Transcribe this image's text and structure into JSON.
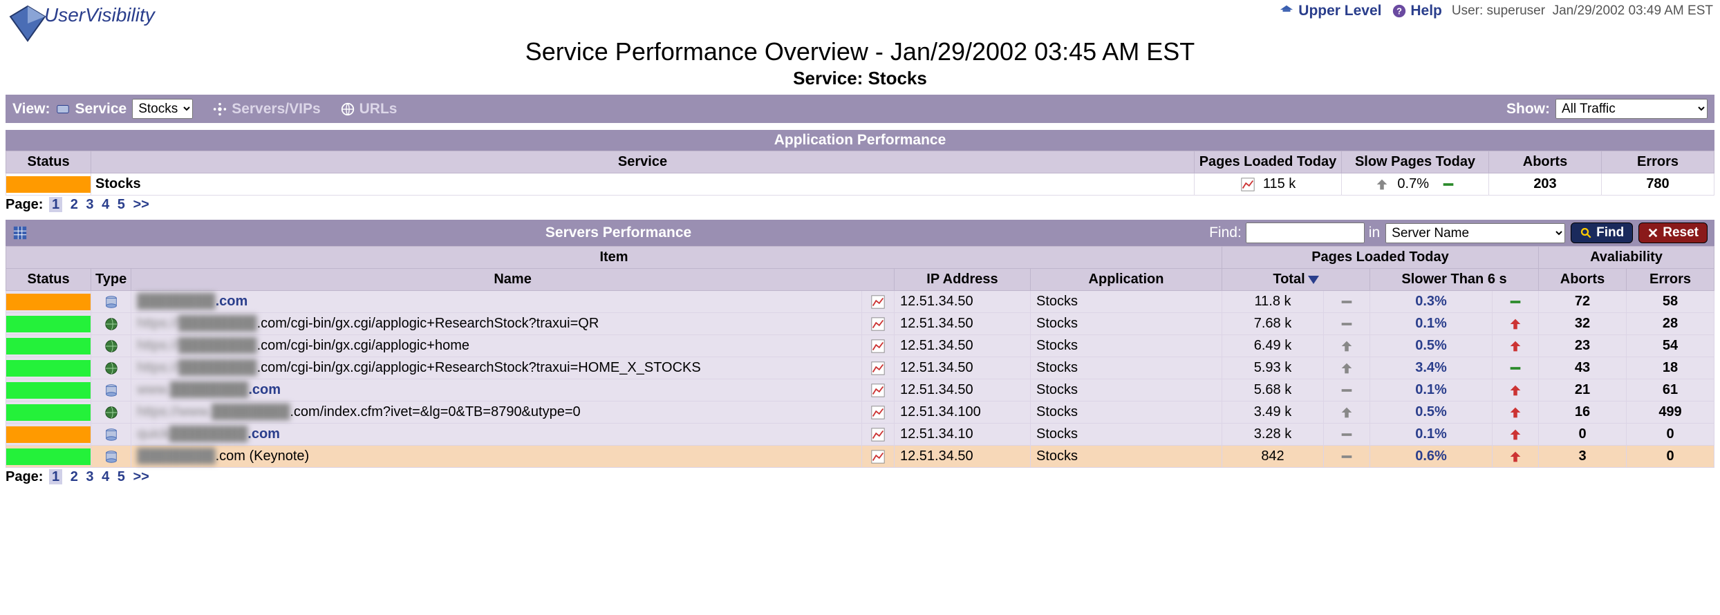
{
  "header": {
    "product_name": "UserVisibility",
    "upper_level": "Upper Level",
    "help": "Help",
    "user_label": "User:",
    "user_name": "superuser",
    "timestamp": "Jan/29/2002 03:49 AM EST"
  },
  "title": {
    "main": "Service Performance Overview - Jan/29/2002 03:45 AM EST",
    "sub_prefix": "Service:",
    "sub_value": "Stocks"
  },
  "toolbar": {
    "view_label": "View:",
    "service_label": "Service",
    "service_selected": "Stocks",
    "servers_vips": "Servers/VIPs",
    "urls": "URLs",
    "show_label": "Show:",
    "show_selected": "All Traffic"
  },
  "app_perf": {
    "section": "Application Performance",
    "cols": {
      "status": "Status",
      "service": "Service",
      "pages": "Pages Loaded Today",
      "slow": "Slow Pages Today",
      "aborts": "Aborts",
      "errors": "Errors"
    },
    "row": {
      "status_color": "orange",
      "service": "Stocks",
      "pages": "115 k",
      "slow": "0.7%",
      "aborts": "203",
      "errors": "780"
    }
  },
  "pagination": {
    "label": "Page:",
    "current": "1",
    "pages": [
      "2",
      "3",
      "4",
      "5"
    ],
    "next": ">>"
  },
  "srv_hdr": {
    "section": "Servers Performance",
    "find_label": "Find:",
    "in_label": "in",
    "in_selected": "Server Name",
    "find_btn": "Find",
    "reset_btn": "Reset"
  },
  "srv_cols": {
    "item": "Item",
    "pages_loaded": "Pages Loaded Today",
    "availability": "Avaliability",
    "status": "Status",
    "type": "Type",
    "name": "Name",
    "ip": "IP Address",
    "application": "Application",
    "total": "Total",
    "slower": "Slower Than 6 s",
    "aborts": "Aborts",
    "errors": "Errors"
  },
  "srv_rows": [
    {
      "status": "orange",
      "type": "server",
      "name_prefix": "████████",
      "name_suffix": ".com",
      "link": true,
      "ip": "12.51.34.50",
      "app": "Stocks",
      "total": "11.8 k",
      "trend1": "flat",
      "slow": "0.3%",
      "trend2": "flat-green",
      "aborts": "72",
      "errors": "58",
      "hl": false
    },
    {
      "status": "green",
      "type": "url",
      "name_prefix": "https://████████",
      "name_suffix": ".com/cgi-bin/gx.cgi/applogic+ResearchStock?traxui=QR",
      "link": false,
      "ip": "12.51.34.50",
      "app": "Stocks",
      "total": "7.68 k",
      "trend1": "flat",
      "slow": "0.1%",
      "trend2": "up-red",
      "aborts": "32",
      "errors": "28",
      "hl": false
    },
    {
      "status": "green",
      "type": "url",
      "name_prefix": "https://████████",
      "name_suffix": ".com/cgi-bin/gx.cgi/applogic+home",
      "link": false,
      "ip": "12.51.34.50",
      "app": "Stocks",
      "total": "6.49 k",
      "trend1": "up",
      "slow": "0.5%",
      "trend2": "up-red",
      "aborts": "23",
      "errors": "54",
      "hl": false
    },
    {
      "status": "green",
      "type": "url",
      "name_prefix": "https://████████",
      "name_suffix": ".com/cgi-bin/gx.cgi/applogic+ResearchStock?traxui=HOME_X_STOCKS",
      "link": false,
      "ip": "12.51.34.50",
      "app": "Stocks",
      "total": "5.93 k",
      "trend1": "up",
      "slow": "3.4%",
      "trend2": "flat-green",
      "aborts": "43",
      "errors": "18",
      "hl": false
    },
    {
      "status": "green",
      "type": "server",
      "name_prefix": "www.████████",
      "name_suffix": ".com",
      "link": true,
      "ip": "12.51.34.50",
      "app": "Stocks",
      "total": "5.68 k",
      "trend1": "flat",
      "slow": "0.1%",
      "trend2": "up-red",
      "aborts": "21",
      "errors": "61",
      "hl": false
    },
    {
      "status": "green",
      "type": "url",
      "name_prefix": "https://www.████████",
      "name_suffix": ".com/index.cfm?ivet=&lg=0&TB=8790&utype=0",
      "link": false,
      "ip": "12.51.34.100",
      "app": "Stocks",
      "total": "3.49 k",
      "trend1": "up",
      "slow": "0.5%",
      "trend2": "up-red",
      "aborts": "16",
      "errors": "499",
      "hl": false
    },
    {
      "status": "orange",
      "type": "server",
      "name_prefix": "quick████████",
      "name_suffix": ".com",
      "link": true,
      "ip": "12.51.34.10",
      "app": "Stocks",
      "total": "3.28 k",
      "trend1": "flat",
      "slow": "0.1%",
      "trend2": "up-red",
      "aborts": "0",
      "errors": "0",
      "hl": false
    },
    {
      "status": "green",
      "type": "server",
      "name_prefix": "████████",
      "name_suffix": ".com (Keynote)",
      "link": false,
      "ip": "12.51.34.50",
      "app": "Stocks",
      "total": "842",
      "trend1": "flat",
      "slow": "0.6%",
      "trend2": "up-red",
      "aborts": "3",
      "errors": "0",
      "hl": true
    }
  ]
}
